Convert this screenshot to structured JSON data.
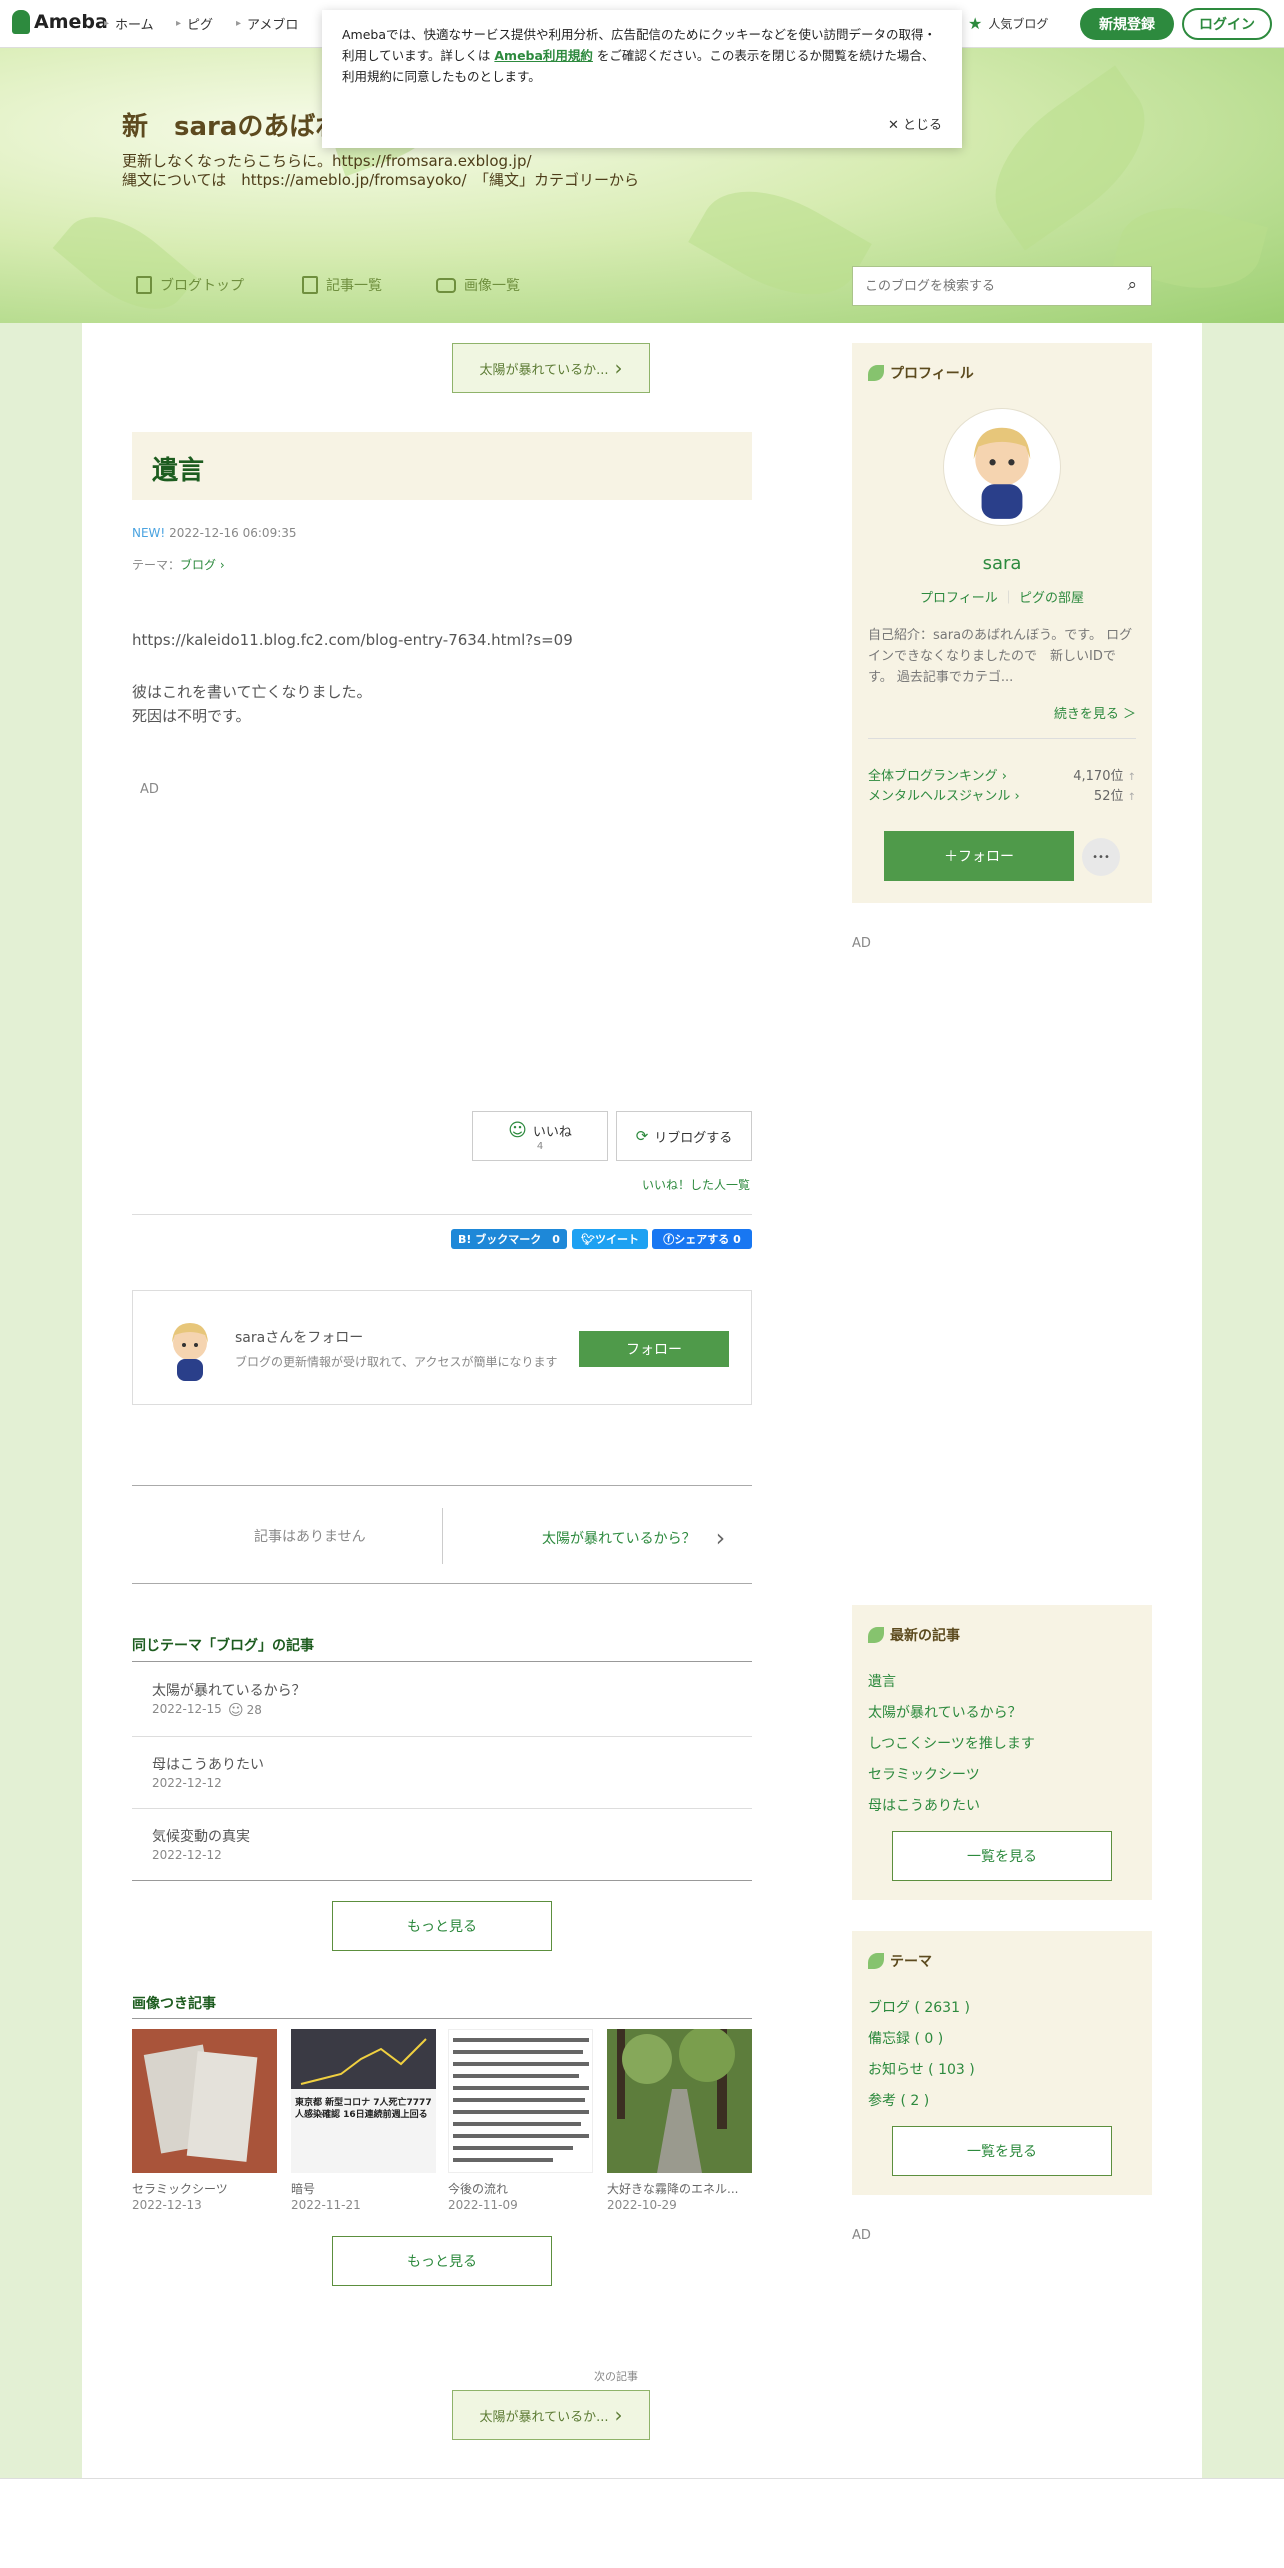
{
  "topbar": {
    "logo": "Ameba",
    "nav": [
      "ホーム",
      "ピグ",
      "アメブロ"
    ],
    "popular": "人気ブログ",
    "signup": "新規登録",
    "login": "ログイン"
  },
  "cookie": {
    "text1": "Amebaでは、快適なサービス提供や利用分析、広告配信のためにクッキーなどを使い訪問データの取得・利用しています。詳しくは",
    "link": "Ameba利用規約",
    "text2": "をご確認ください。この表示を閉じるか閲覧を続けた場合、利用規約に同意したものとします。",
    "close": "とじる"
  },
  "blog": {
    "title": "新　saraのあばれ",
    "desc1": "更新しなくなったらこちらに。https://fromsara.exblog.jp/",
    "desc2": "縄文については　https://ameblo.jp/fromsayoko/　「縄文」カテゴリーから",
    "nav": [
      "ブログトップ",
      "記事一覧",
      "画像一覧"
    ],
    "search_placeholder": "このブログを検索する"
  },
  "entry": {
    "prev_top": "太陽が暴れているか...",
    "title": "遺言",
    "new": "NEW!",
    "date": "2022-12-16 06:09:35",
    "theme_label": "テーマ：",
    "theme": "ブログ",
    "url": "https://kaleido11.blog.fc2.com/blog-entry-7634.html?s=09",
    "line1": "彼はこれを書いて亡くなりました。",
    "line2": "死因は不明です。",
    "ad": "AD",
    "like": "いいね",
    "like_count": "4",
    "reblog": "リブログする",
    "like_list": "いいね！した人一覧",
    "hatena": "B! ブックマーク　0",
    "tweet": "ツイート",
    "share": "シェアする 0"
  },
  "follow": {
    "name": "saraさんをフォロー",
    "desc": "ブログの更新情報が受け取れて、アクセスが簡単になります",
    "button": "フォロー"
  },
  "pager": {
    "none": "記事はありません",
    "next": "太陽が暴れているから？"
  },
  "same_theme": {
    "heading": "同じテーマ「ブログ」の記事",
    "items": [
      {
        "title": "太陽が暴れているから？",
        "date": "2022-12-15",
        "likes": "28"
      },
      {
        "title": "母はこうありたい",
        "date": "2022-12-12"
      },
      {
        "title": "気候変動の真実",
        "date": "2022-12-12"
      }
    ],
    "more": "もっと見る"
  },
  "image_posts": {
    "heading": "画像つき記事",
    "items": [
      {
        "title": "セラミックシーツ",
        "date": "2022-12-13"
      },
      {
        "title": "暗号",
        "date": "2022-11-21"
      },
      {
        "title": "今後の流れ",
        "date": "2022-11-09"
      },
      {
        "title": "大好きな霧降のエネル...",
        "date": "2022-10-29"
      }
    ],
    "thumb2_text": "東京都 新型コロナ 7人死亡7777人感染確認 16日連続前週上回る",
    "more": "もっと見る"
  },
  "bottom": {
    "next_label": "次の記事",
    "next": "太陽が暴れているか..."
  },
  "profile": {
    "heading": "プロフィール",
    "name": "sara",
    "link1": "プロフィール",
    "link2": "ピグの部屋",
    "intro": "自己紹介：saraのあばれんぼう。です。 ログインできなくなりましたので　新しいIDです。 過去記事でカテゴ...",
    "more": "続きを見る ＞",
    "rank1_label": "全体ブログランキング",
    "rank1": "4,170位",
    "rank2_label": "メンタルヘルスジャンル",
    "rank2": "52位",
    "follow": "＋フォロー",
    "dots": "•••"
  },
  "sidebar_ad": "AD",
  "latest": {
    "heading": "最新の記事",
    "items": [
      "遺言",
      "太陽が暴れているから？",
      "しつこくシーツを推します",
      "セラミックシーツ",
      "母はこうありたい"
    ],
    "more": "一覧を見る"
  },
  "themes": {
    "heading": "テーマ",
    "items": [
      "ブログ ( 2631 )",
      "備忘録 ( 0 )",
      "お知らせ ( 103 )",
      "参考 ( 2 )"
    ],
    "more": "一覧を見る"
  },
  "sidebar_ad2": "AD",
  "colors": {
    "brand": "#2d8a3e",
    "accent": "#6f8f3e",
    "title": "#1d5c1f"
  }
}
